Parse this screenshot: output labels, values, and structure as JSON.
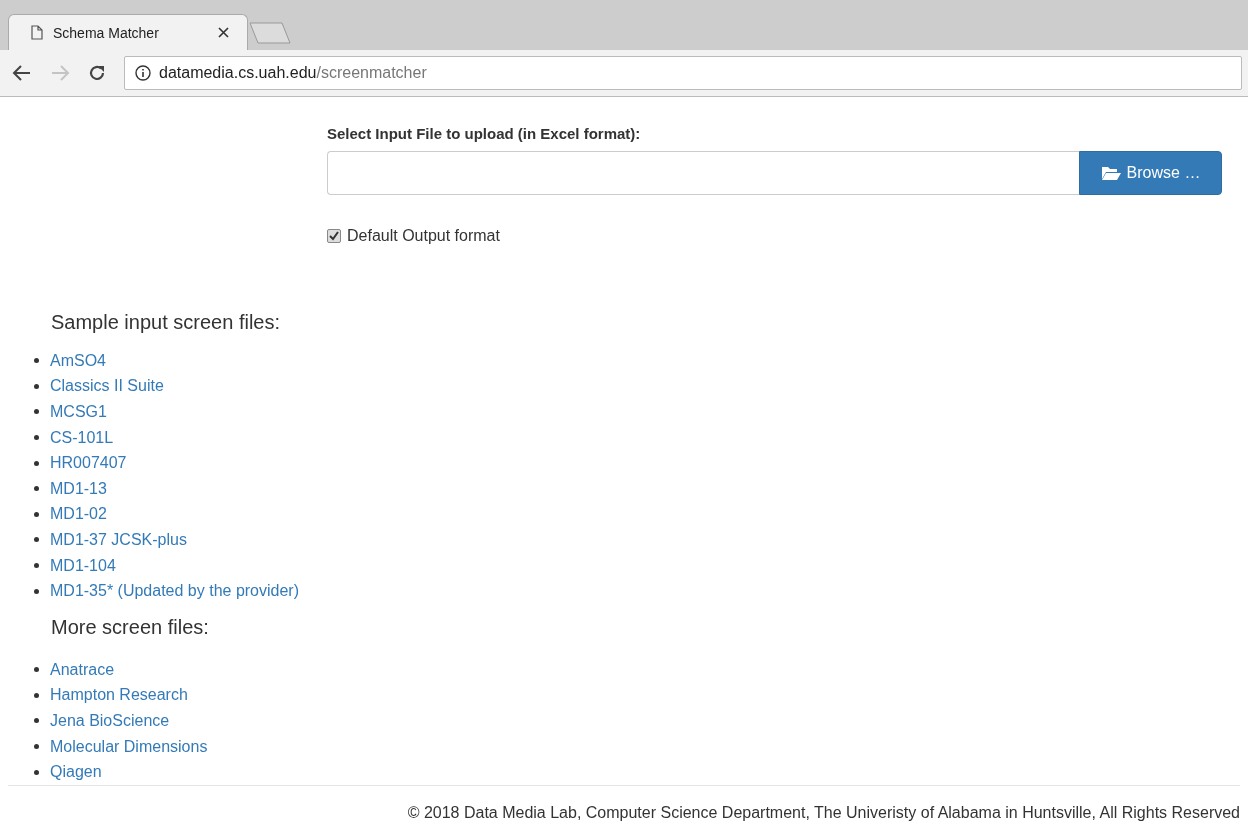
{
  "browser": {
    "tab": {
      "title": "Schema Matcher",
      "selected": true
    },
    "address": {
      "host": "datamedia.cs.uah.edu",
      "path": "/screenmatcher"
    }
  },
  "upload": {
    "label": "Select Input File to upload (in Excel format):",
    "button": "Browse …"
  },
  "default_output": {
    "label": "Default Output format",
    "checked": true
  },
  "sections": [
    {
      "heading": "Sample input screen files:",
      "links": [
        "AmSO4",
        "Classics II Suite",
        "MCSG1",
        "CS-101L",
        "HR007407",
        "MD1-13",
        "MD1-02",
        "MD1-37 JCSK-plus",
        "MD1-104",
        "MD1-35* (Updated by the provider)"
      ]
    },
    {
      "heading": "More screen files:",
      "links": [
        "Anatrace",
        "Hampton Research",
        "Jena BioScience",
        "Molecular Dimensions",
        "Qiagen"
      ]
    }
  ],
  "footer": "© 2018 Data Media Lab, Computer Science Department, The Univeristy of Alabama in Huntsville, All Rights Reserved"
}
